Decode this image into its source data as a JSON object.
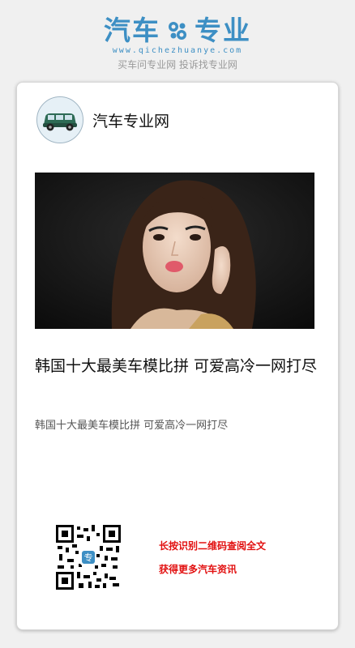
{
  "header": {
    "logo_left": "汽车",
    "logo_right": "专业",
    "domain": "www.qichezhuanye.com",
    "slogan": "买车问专业网 投诉找专业网"
  },
  "profile": {
    "name": "汽车专业网",
    "avatar_icon": "car-icon"
  },
  "article": {
    "title": "韩国十大最美车模比拼 可爱高冷一网打尽",
    "description": "韩国十大最美车模比拼 可爱高冷一网打尽"
  },
  "qr": {
    "line1": "长按识别二维码查阅全文",
    "line2": "获得更多汽车资讯"
  },
  "colors": {
    "brand_blue": "#3d8fc4",
    "accent_red": "#e21010"
  }
}
